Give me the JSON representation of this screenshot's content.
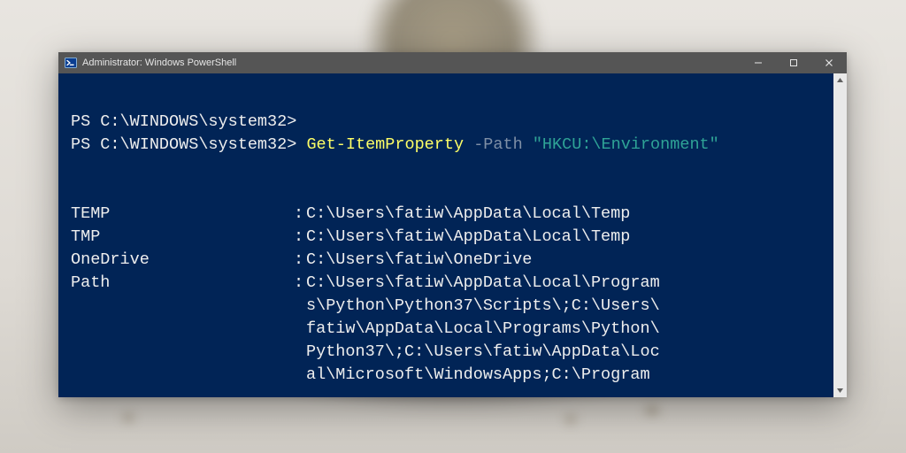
{
  "window": {
    "title": "Administrator: Windows PowerShell"
  },
  "colors": {
    "console_bg": "#012456",
    "titlebar_bg": "#555555",
    "cmdlet": "#ffff66",
    "param": "#7f8fa6",
    "string": "#2fa396",
    "text": "#eeeeee"
  },
  "prompt": {
    "line1": "PS C:\\WINDOWS\\system32>",
    "line2_prompt": "PS C:\\WINDOWS\\system32> ",
    "cmdlet": "Get-ItemProperty",
    "param": " -Path ",
    "arg": "\"HKCU:\\Environment\""
  },
  "output": {
    "sep": ": ",
    "rows": [
      {
        "key": "TEMP",
        "value": "C:\\Users\\fatiw\\AppData\\Local\\Temp"
      },
      {
        "key": "TMP",
        "value": "C:\\Users\\fatiw\\AppData\\Local\\Temp"
      },
      {
        "key": "OneDrive",
        "value": "C:\\Users\\fatiw\\OneDrive"
      },
      {
        "key": "Path",
        "value_lines": [
          "C:\\Users\\fatiw\\AppData\\Local\\Program",
          "s\\Python\\Python37\\Scripts\\;C:\\Users\\",
          "fatiw\\AppData\\Local\\Programs\\Python\\",
          "Python37\\;C:\\Users\\fatiw\\AppData\\Loc",
          "al\\Microsoft\\WindowsApps;C:\\Program"
        ]
      }
    ]
  }
}
